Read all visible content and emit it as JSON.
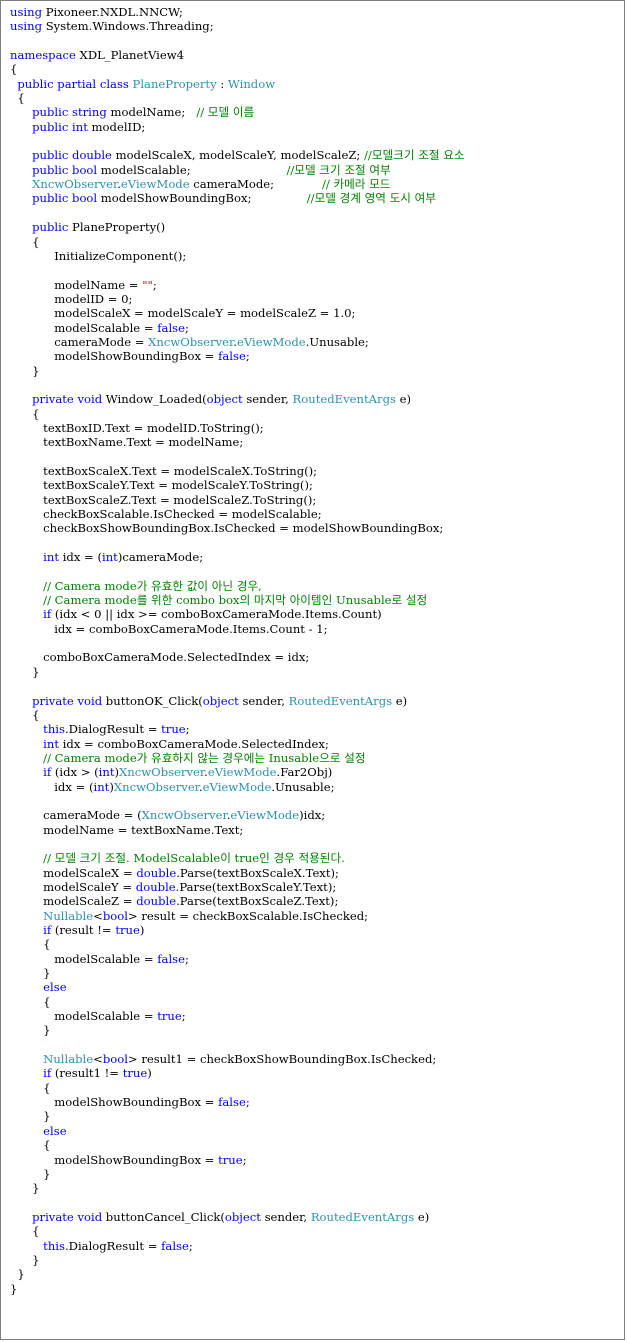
{
  "colors": {
    "background": "#ffffff",
    "border": "#7f7f7f",
    "plain": "#000000",
    "keyword": "#0000ff",
    "type": "#2b91af",
    "comment": "#008000",
    "string": "#a31515"
  },
  "code_lines": [
    [
      [
        "kw",
        "using"
      ],
      [
        "p",
        " Pixoneer.NXDL.NNCW;"
      ]
    ],
    [
      [
        "kw",
        "using"
      ],
      [
        "p",
        " System.Windows.Threading;"
      ]
    ],
    [],
    [
      [
        "kw",
        "namespace"
      ],
      [
        "p",
        " XDL_PlanetView4"
      ]
    ],
    [
      [
        "p",
        "{"
      ]
    ],
    [
      [
        "p",
        "  "
      ],
      [
        "kw",
        "public partial class"
      ],
      [
        "p",
        " "
      ],
      [
        "ty",
        "PlaneProperty"
      ],
      [
        "p",
        " : "
      ],
      [
        "ty",
        "Window"
      ]
    ],
    [
      [
        "p",
        "  {"
      ]
    ],
    [
      [
        "p",
        "      "
      ],
      [
        "kw",
        "public string"
      ],
      [
        "p",
        " modelName;   "
      ],
      [
        "cm",
        "// 모델 이름"
      ]
    ],
    [
      [
        "p",
        "      "
      ],
      [
        "kw",
        "public int"
      ],
      [
        "p",
        " modelID;"
      ]
    ],
    [],
    [
      [
        "p",
        "      "
      ],
      [
        "kw",
        "public double"
      ],
      [
        "p",
        " modelScaleX, modelScaleY, modelScaleZ; "
      ],
      [
        "cm",
        "//모델크기 조절 요소"
      ]
    ],
    [
      [
        "p",
        "      "
      ],
      [
        "kw",
        "public bool"
      ],
      [
        "p",
        " modelScalable;                          "
      ],
      [
        "cm",
        "//모델 크기 조절 여부"
      ]
    ],
    [
      [
        "p",
        "      "
      ],
      [
        "ty",
        "XncwObserver"
      ],
      [
        "p",
        "."
      ],
      [
        "ty",
        "eViewMode"
      ],
      [
        "p",
        " cameraMode;             "
      ],
      [
        "cm",
        "// 카메라 모드"
      ]
    ],
    [
      [
        "p",
        "      "
      ],
      [
        "kw",
        "public bool"
      ],
      [
        "p",
        " modelShowBoundingBox;               "
      ],
      [
        "cm",
        "//모델 경계 영역 도시 여부"
      ]
    ],
    [],
    [
      [
        "p",
        "      "
      ],
      [
        "kw",
        "public"
      ],
      [
        "p",
        " PlaneProperty()"
      ]
    ],
    [
      [
        "p",
        "      {"
      ]
    ],
    [
      [
        "p",
        "            InitializeComponent();"
      ]
    ],
    [],
    [
      [
        "p",
        "            modelName = "
      ],
      [
        "st",
        "\"\""
      ],
      [
        "p",
        ";"
      ]
    ],
    [
      [
        "p",
        "            modelID = 0;"
      ]
    ],
    [
      [
        "p",
        "            modelScaleX = modelScaleY = modelScaleZ = 1.0;"
      ]
    ],
    [
      [
        "p",
        "            modelScalable = "
      ],
      [
        "kw",
        "false"
      ],
      [
        "p",
        ";"
      ]
    ],
    [
      [
        "p",
        "            cameraMode = "
      ],
      [
        "ty",
        "XncwObserver"
      ],
      [
        "p",
        "."
      ],
      [
        "ty",
        "eViewMode"
      ],
      [
        "p",
        ".Unusable;"
      ]
    ],
    [
      [
        "p",
        "            modelShowBoundingBox = "
      ],
      [
        "kw",
        "false"
      ],
      [
        "p",
        ";"
      ]
    ],
    [
      [
        "p",
        "      }"
      ]
    ],
    [],
    [
      [
        "p",
        "      "
      ],
      [
        "kw",
        "private void"
      ],
      [
        "p",
        " Window_Loaded("
      ],
      [
        "kw",
        "object"
      ],
      [
        "p",
        " sender, "
      ],
      [
        "ty",
        "RoutedEventArgs"
      ],
      [
        "p",
        " e)"
      ]
    ],
    [
      [
        "p",
        "      {"
      ]
    ],
    [
      [
        "p",
        "         textBoxID.Text = modelID.ToString();"
      ]
    ],
    [
      [
        "p",
        "         textBoxName.Text = modelName;"
      ]
    ],
    [],
    [
      [
        "p",
        "         textBoxScaleX.Text = modelScaleX.ToString();"
      ]
    ],
    [
      [
        "p",
        "         textBoxScaleY.Text = modelScaleY.ToString();"
      ]
    ],
    [
      [
        "p",
        "         textBoxScaleZ.Text = modelScaleZ.ToString();"
      ]
    ],
    [
      [
        "p",
        "         checkBoxScalable.IsChecked = modelScalable;"
      ]
    ],
    [
      [
        "p",
        "         checkBoxShowBoundingBox.IsChecked = modelShowBoundingBox;"
      ]
    ],
    [],
    [
      [
        "p",
        "         "
      ],
      [
        "kw",
        "int"
      ],
      [
        "p",
        " idx = ("
      ],
      [
        "kw",
        "int"
      ],
      [
        "p",
        ")cameraMode;"
      ]
    ],
    [],
    [
      [
        "p",
        "         "
      ],
      [
        "cm",
        "// Camera mode가 유효한 값이 아닌 경우,"
      ]
    ],
    [
      [
        "p",
        "         "
      ],
      [
        "cm",
        "// Camera mode를 위한 combo box의 마지막 아이템인 Unusable로 설정"
      ]
    ],
    [
      [
        "p",
        "         "
      ],
      [
        "kw",
        "if"
      ],
      [
        "p",
        " (idx < 0 || idx >= comboBoxCameraMode.Items.Count)"
      ]
    ],
    [
      [
        "p",
        "            idx = comboBoxCameraMode.Items.Count - 1;"
      ]
    ],
    [],
    [
      [
        "p",
        "         comboBoxCameraMode.SelectedIndex = idx;"
      ]
    ],
    [
      [
        "p",
        "      }"
      ]
    ],
    [],
    [
      [
        "p",
        "      "
      ],
      [
        "kw",
        "private void"
      ],
      [
        "p",
        " buttonOK_Click("
      ],
      [
        "kw",
        "object"
      ],
      [
        "p",
        " sender, "
      ],
      [
        "ty",
        "RoutedEventArgs"
      ],
      [
        "p",
        " e)"
      ]
    ],
    [
      [
        "p",
        "      {"
      ]
    ],
    [
      [
        "p",
        "         "
      ],
      [
        "kw",
        "this"
      ],
      [
        "p",
        ".DialogResult = "
      ],
      [
        "kw",
        "true"
      ],
      [
        "p",
        ";"
      ]
    ],
    [
      [
        "p",
        "         "
      ],
      [
        "kw",
        "int"
      ],
      [
        "p",
        " idx = comboBoxCameraMode.SelectedIndex;"
      ]
    ],
    [
      [
        "p",
        "         "
      ],
      [
        "cm",
        "// Camera mode가 유효하지 않는 경우에는 Inusable으로 설정"
      ]
    ],
    [
      [
        "p",
        "         "
      ],
      [
        "kw",
        "if"
      ],
      [
        "p",
        " (idx > ("
      ],
      [
        "kw",
        "int"
      ],
      [
        "p",
        ")"
      ],
      [
        "ty",
        "XncwObserver"
      ],
      [
        "p",
        "."
      ],
      [
        "ty",
        "eViewMode"
      ],
      [
        "p",
        ".Far2Obj)"
      ]
    ],
    [
      [
        "p",
        "            idx = ("
      ],
      [
        "kw",
        "int"
      ],
      [
        "p",
        ")"
      ],
      [
        "ty",
        "XncwObserver"
      ],
      [
        "p",
        "."
      ],
      [
        "ty",
        "eViewMode"
      ],
      [
        "p",
        ".Unusable;"
      ]
    ],
    [],
    [
      [
        "p",
        "         cameraMode = ("
      ],
      [
        "ty",
        "XncwObserver"
      ],
      [
        "p",
        "."
      ],
      [
        "ty",
        "eViewMode"
      ],
      [
        "p",
        ")idx;"
      ]
    ],
    [
      [
        "p",
        "         modelName = textBoxName.Text;"
      ]
    ],
    [],
    [
      [
        "p",
        "         "
      ],
      [
        "cm",
        "// 모델 크기 조절. ModelScalable이 true인 경우 적용된다."
      ]
    ],
    [
      [
        "p",
        "         modelScaleX = "
      ],
      [
        "kw",
        "double"
      ],
      [
        "p",
        ".Parse(textBoxScaleX.Text);"
      ]
    ],
    [
      [
        "p",
        "         modelScaleY = "
      ],
      [
        "kw",
        "double"
      ],
      [
        "p",
        ".Parse(textBoxScaleY.Text);"
      ]
    ],
    [
      [
        "p",
        "         modelScaleZ = "
      ],
      [
        "kw",
        "double"
      ],
      [
        "p",
        ".Parse(textBoxScaleZ.Text);"
      ]
    ],
    [
      [
        "p",
        "         "
      ],
      [
        "ty",
        "Nullable"
      ],
      [
        "p",
        "<"
      ],
      [
        "kw",
        "bool"
      ],
      [
        "p",
        "> result = checkBoxScalable.IsChecked;"
      ]
    ],
    [
      [
        "p",
        "         "
      ],
      [
        "kw",
        "if"
      ],
      [
        "p",
        " (result != "
      ],
      [
        "kw",
        "true"
      ],
      [
        "p",
        ")"
      ]
    ],
    [
      [
        "p",
        "         {"
      ]
    ],
    [
      [
        "p",
        "            modelScalable = "
      ],
      [
        "kw",
        "false"
      ],
      [
        "p",
        ";"
      ]
    ],
    [
      [
        "p",
        "         }"
      ]
    ],
    [
      [
        "p",
        "         "
      ],
      [
        "kw",
        "else"
      ]
    ],
    [
      [
        "p",
        "         {"
      ]
    ],
    [
      [
        "p",
        "            modelScalable = "
      ],
      [
        "kw",
        "true"
      ],
      [
        "p",
        ";"
      ]
    ],
    [
      [
        "p",
        "         }"
      ]
    ],
    [],
    [
      [
        "p",
        "         "
      ],
      [
        "ty",
        "Nullable"
      ],
      [
        "p",
        "<"
      ],
      [
        "kw",
        "bool"
      ],
      [
        "p",
        "> result1 = checkBoxShowBoundingBox.IsChecked;"
      ]
    ],
    [
      [
        "p",
        "         "
      ],
      [
        "kw",
        "if"
      ],
      [
        "p",
        " (result1 != "
      ],
      [
        "kw",
        "true"
      ],
      [
        "p",
        ")"
      ]
    ],
    [
      [
        "p",
        "         {"
      ]
    ],
    [
      [
        "p",
        "            modelShowBoundingBox = "
      ],
      [
        "kw",
        "false"
      ],
      [
        "p",
        ";"
      ]
    ],
    [
      [
        "p",
        "         }"
      ]
    ],
    [
      [
        "p",
        "         "
      ],
      [
        "kw",
        "else"
      ]
    ],
    [
      [
        "p",
        "         {"
      ]
    ],
    [
      [
        "p",
        "            modelShowBoundingBox = "
      ],
      [
        "kw",
        "true"
      ],
      [
        "p",
        ";"
      ]
    ],
    [
      [
        "p",
        "         }"
      ]
    ],
    [
      [
        "p",
        "      }"
      ]
    ],
    [],
    [
      [
        "p",
        "      "
      ],
      [
        "kw",
        "private void"
      ],
      [
        "p",
        " buttonCancel_Click("
      ],
      [
        "kw",
        "object"
      ],
      [
        "p",
        " sender, "
      ],
      [
        "ty",
        "RoutedEventArgs"
      ],
      [
        "p",
        " e)"
      ]
    ],
    [
      [
        "p",
        "      {"
      ]
    ],
    [
      [
        "p",
        "         "
      ],
      [
        "kw",
        "this"
      ],
      [
        "p",
        ".DialogResult = "
      ],
      [
        "kw",
        "false"
      ],
      [
        "p",
        ";"
      ]
    ],
    [
      [
        "p",
        "      }"
      ]
    ],
    [
      [
        "p",
        "  }"
      ]
    ],
    [
      [
        "p",
        "}"
      ]
    ]
  ]
}
